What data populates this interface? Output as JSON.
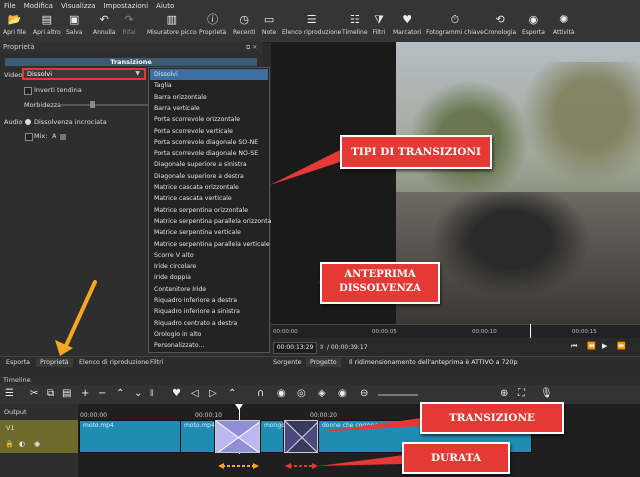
{
  "menubar": {
    "items": [
      "File",
      "Modifica",
      "Visualizza",
      "Impostazioni",
      "Aiuto"
    ]
  },
  "toolbar": {
    "buttons": [
      {
        "label": "Apri file",
        "icon": "open-folder-icon"
      },
      {
        "label": "Apri altro",
        "icon": "open-other-icon"
      },
      {
        "label": "Salva",
        "icon": "save-icon"
      },
      {
        "label": "Annulla",
        "icon": "undo-icon"
      },
      {
        "label": "Rifai",
        "icon": "redo-icon"
      },
      {
        "label": "Misuratore picco",
        "icon": "peak-meter-icon"
      },
      {
        "label": "Proprietà",
        "icon": "info-icon"
      },
      {
        "label": "Recenti",
        "icon": "recent-clock-icon"
      },
      {
        "label": "Note",
        "icon": "note-icon"
      },
      {
        "label": "Elenco riproduzione",
        "icon": "playlist-icon"
      },
      {
        "label": "Timeline",
        "icon": "timeline-icon"
      },
      {
        "label": "Filtri",
        "icon": "filter-icon"
      },
      {
        "label": "Marcatori",
        "icon": "marker-icon"
      },
      {
        "label": "Fotogrammi chiave",
        "icon": "keyframes-icon"
      },
      {
        "label": "Cronologia",
        "icon": "history-icon"
      },
      {
        "label": "Esporta",
        "icon": "export-icon"
      },
      {
        "label": "Attività",
        "icon": "jobs-icon"
      }
    ]
  },
  "properties": {
    "title": "Proprietà",
    "header": "Transizione",
    "video_label": "Video",
    "video_value": "Dissolvi",
    "invert_label": "Inverti tendina",
    "softness_label": "Morbidezza",
    "audio_label": "Audio",
    "crossfade_label": "Dissolvenza incrociata",
    "mix_label": "Mix:",
    "mix_value": "A"
  },
  "dropdown": {
    "items": [
      "Dissolvi",
      "Taglia",
      "Barra orizzontale",
      "Barra verticale",
      "Porta scorrevole orizzontale",
      "Porta scorrevole verticale",
      "Porta scorrevole diagonale SO-NE",
      "Porta scorrevole diagonale NO-SE",
      "Diagonale superiore a sinistra",
      "Diagonale superiore a destra",
      "Matrice cascata orizzontale",
      "Matrice cascata verticale",
      "Matrice serpentina orizzontale",
      "Matrice serpentina parallela orizzontale",
      "Matrice serpentina verticale",
      "Matrice serpentina parallela verticale",
      "Scorre V alto",
      "Iride circolare",
      "Iride doppia",
      "Contenitore Iride",
      "Riquadro inferiore a destra",
      "Riquadro inferiore a sinistra",
      "Riquadro centrato a destra",
      "Orologio in alto",
      "Personalizzato..."
    ]
  },
  "preview": {
    "ruler_ticks": [
      "00:00:00",
      "00:00:05",
      "00:00:10",
      "00:00:15"
    ],
    "timecode": "00:00:13:29",
    "duration": "/ 00:00:39:17",
    "tabs": [
      "Sorgente",
      "Progetto"
    ],
    "status": "Il ridimensionamento dell'anteprima è ATTIVO a 720p"
  },
  "bottom_tabs": [
    "Esporta",
    "Proprietà",
    "Elenco di riproduzione",
    "Filtri"
  ],
  "timeline": {
    "title": "Timeline",
    "output_label": "Output",
    "track_label": "V1",
    "ticks": [
      "00:00:00",
      "00:00:10",
      "00:00:20"
    ],
    "clips": [
      "moto.mp4",
      "moto.mp4",
      "mongolfi",
      "donne che corrono.mp4"
    ]
  },
  "annotations": {
    "tipi": "TIPI DI TRANSIZIONI",
    "anteprima_1": "ANTEPRIMA",
    "anteprima_2": "DISSOLVENZA",
    "transizione": "TRANSIZIONE",
    "durata": "DURATA"
  },
  "colors": {
    "accent_red": "#e53935",
    "clip_blue": "#1f8db3",
    "track_olive": "#6c6b2a",
    "annotation_orange": "#f5a623"
  }
}
